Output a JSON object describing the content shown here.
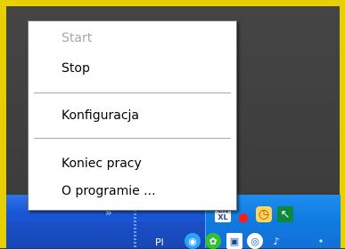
{
  "menu": {
    "items": [
      {
        "label": "Start",
        "enabled": false
      },
      {
        "label": "Stop",
        "enabled": true
      },
      {
        "label": "Konfiguracja",
        "enabled": true
      },
      {
        "label": "Koniec pracy",
        "enabled": true
      },
      {
        "label": "O programie ...",
        "enabled": true
      }
    ]
  },
  "taskbar": {
    "chevron": "»",
    "clipped_label": "Pl",
    "tray_icon_text": "CN\nXL"
  },
  "colors": {
    "frame": "#e8d000",
    "taskbar": "#1856d8",
    "tray": "#0f7ae0",
    "menu_bg": "#ffffff",
    "disabled_text": "#a8a8a8"
  }
}
